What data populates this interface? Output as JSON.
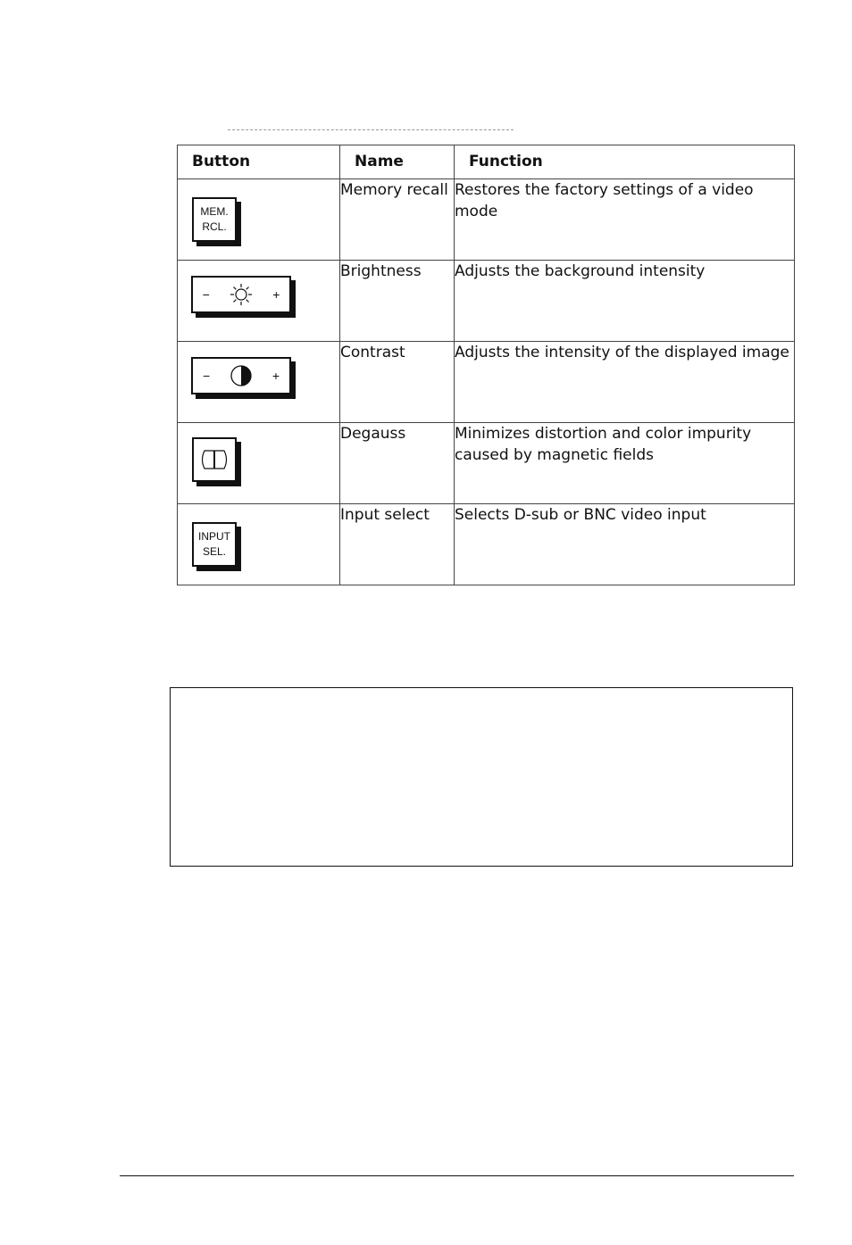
{
  "table": {
    "headers": [
      "Button",
      "Name",
      "Function"
    ],
    "rows": [
      {
        "button_icon": "mem-rcl-key-icon",
        "button_label_lines": [
          "MEM.",
          "RCL."
        ],
        "name": "Memory recall",
        "function": "Restores the factory settings of a video mode"
      },
      {
        "button_icon": "brightness-key-icon",
        "button_symbols": [
          "−",
          "+"
        ],
        "name": "Brightness",
        "function": "Adjusts the background intensity"
      },
      {
        "button_icon": "contrast-key-icon",
        "button_symbols": [
          "−",
          "+"
        ],
        "name": "Contrast",
        "function": "Adjusts the intensity of the displayed image"
      },
      {
        "button_icon": "degauss-key-icon",
        "name": "Degauss",
        "function": "Minimizes distortion and color impurity caused by magnetic fields"
      },
      {
        "button_icon": "input-sel-key-icon",
        "button_label_lines": [
          "INPUT",
          "SEL."
        ],
        "name": "Input select",
        "function": "Selects D-sub or BNC video input"
      }
    ]
  }
}
